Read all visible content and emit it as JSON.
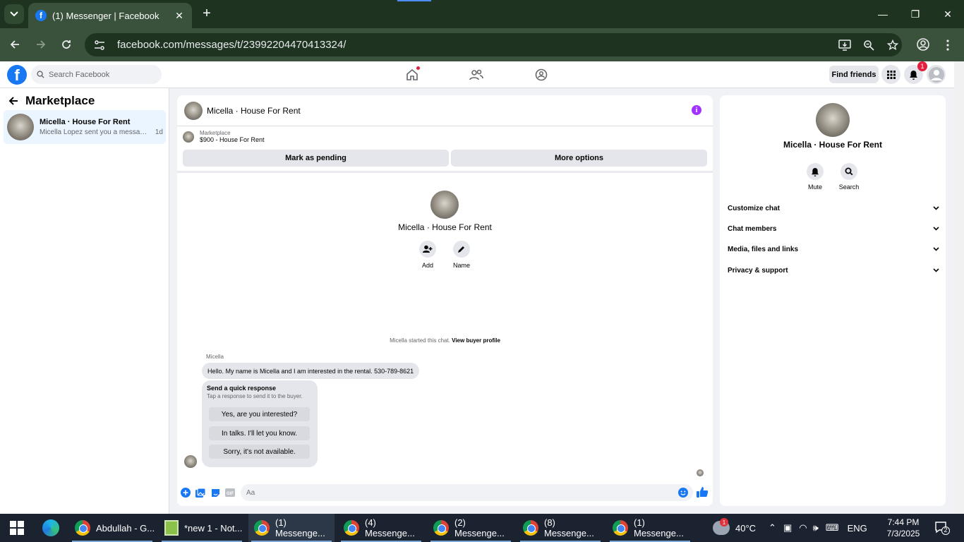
{
  "browser": {
    "tab_title": "(1) Messenger | Facebook",
    "url": "facebook.com/messages/t/23992204470413324/"
  },
  "fb_header": {
    "search_placeholder": "Search Facebook",
    "find_friends_label": "Find friends",
    "notification_count": "1"
  },
  "sidebar": {
    "title": "Marketplace",
    "conversations": [
      {
        "name": "Micella · House For Rent",
        "preview": "Micella Lopez sent you a message about...",
        "time": "1d"
      }
    ]
  },
  "chat": {
    "title": "Micella · House For Rent",
    "listing_label": "Marketplace",
    "listing_title": "$900 - House For Rent",
    "mark_pending_label": "Mark as pending",
    "more_options_label": "More options",
    "intro_name": "Micella · House For Rent",
    "add_label": "Add",
    "name_label": "Name",
    "started_text": "Micella started this chat.",
    "view_buyer_profile": "View buyer profile",
    "sender_name": "Micella",
    "message": "Hello. My name is Micella and I am interested in the rental. 530-789-8621",
    "quick_response_title": "Send a quick response",
    "quick_response_sub": "Tap a response to send it to the buyer.",
    "quick_responses": [
      "Yes, are you interested?",
      "In talks. I'll let you know.",
      "Sorry, it's not available."
    ],
    "input_placeholder": "Aa"
  },
  "info_panel": {
    "name": "Micella · House For Rent",
    "mute_label": "Mute",
    "search_label": "Search",
    "sections": [
      "Customize chat",
      "Chat members",
      "Media, files and links",
      "Privacy & support"
    ]
  },
  "taskbar": {
    "items": [
      {
        "label": "Abdullah - G...",
        "icon": "chrome-icon"
      },
      {
        "label": "*new 1 - Not...",
        "icon": "notepad-icon"
      },
      {
        "label": "(1) Messenge...",
        "icon": "chrome-icon"
      },
      {
        "label": "(4) Messenge...",
        "icon": "chrome-icon"
      },
      {
        "label": "(2) Messenge...",
        "icon": "chrome-icon"
      },
      {
        "label": "(8) Messenge...",
        "icon": "chrome-icon"
      },
      {
        "label": "(1) Messenge...",
        "icon": "chrome-icon"
      }
    ],
    "weather_badge": "1",
    "temperature": "40°C",
    "language": "ENG",
    "time": "7:44 PM",
    "date": "7/3/2025",
    "notification_count": "2"
  },
  "colors": {
    "fb_blue": "#1877f2",
    "chrome_frame": "#1e3421",
    "info_purple": "#a033ff",
    "badge_red": "#e41e3f"
  }
}
